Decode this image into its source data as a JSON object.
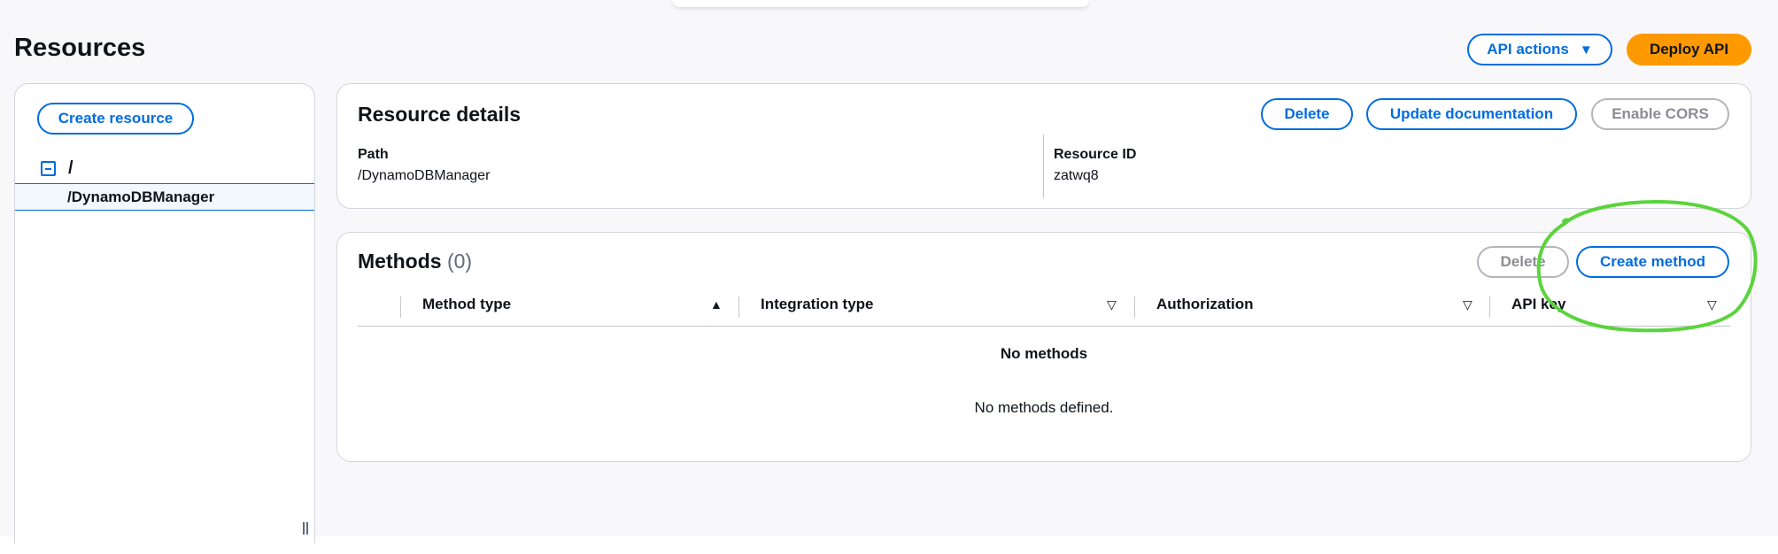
{
  "header": {
    "title": "Resources",
    "api_actions_label": "API actions",
    "deploy_label": "Deploy API"
  },
  "sidebar": {
    "create_resource_label": "Create resource",
    "tree": {
      "root": "/",
      "children": [
        "/DynamoDBManager"
      ]
    }
  },
  "resource_details": {
    "title": "Resource details",
    "delete_label": "Delete",
    "update_docs_label": "Update documentation",
    "enable_cors_label": "Enable CORS",
    "path_label": "Path",
    "path_value": "/DynamoDBManager",
    "resource_id_label": "Resource ID",
    "resource_id_value": "zatwq8"
  },
  "methods": {
    "title": "Methods",
    "count": "(0)",
    "delete_label": "Delete",
    "create_label": "Create method",
    "columns": [
      "Method type",
      "Integration type",
      "Authorization",
      "API key"
    ],
    "empty_title": "No methods",
    "empty_description": "No methods defined."
  },
  "annotation": {
    "color": "#5ad43c"
  }
}
